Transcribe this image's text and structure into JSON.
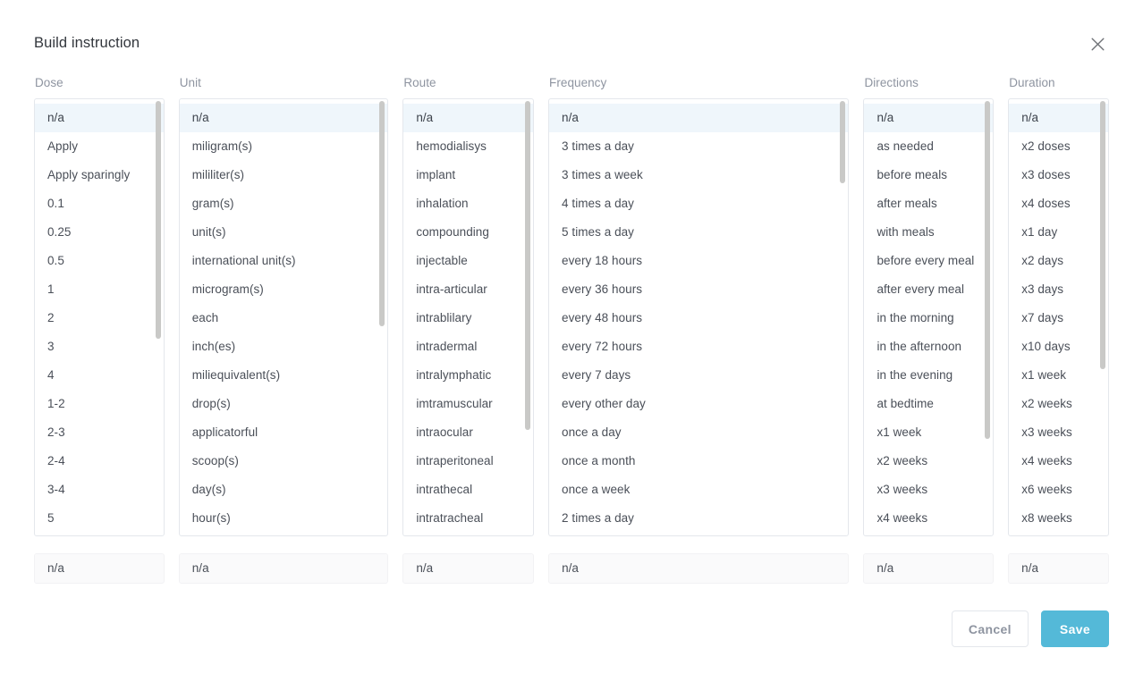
{
  "dialog": {
    "title": "Build instruction",
    "close_icon": "close-icon"
  },
  "columns": [
    {
      "key": "dose",
      "label": "Dose",
      "selected_value": "n/a",
      "scrollbar": {
        "top_pct": 0,
        "height_pct": 55
      },
      "options": [
        "n/a",
        "Apply",
        "Apply sparingly",
        "0.1",
        "0.25",
        "0.5",
        "1",
        "2",
        "3",
        "4",
        "1-2",
        "2-3",
        "2-4",
        "3-4",
        "5"
      ]
    },
    {
      "key": "unit",
      "label": "Unit",
      "selected_value": "n/a",
      "scrollbar": {
        "top_pct": 0,
        "height_pct": 52
      },
      "options": [
        "n/a",
        "miligram(s)",
        "mililiter(s)",
        "gram(s)",
        "unit(s)",
        "international unit(s)",
        "microgram(s)",
        "each",
        "inch(es)",
        "miliequivalent(s)",
        "drop(s)",
        "applicatorful",
        "scoop(s)",
        "day(s)",
        "hour(s)"
      ]
    },
    {
      "key": "route",
      "label": "Route",
      "selected_value": "n/a",
      "scrollbar": {
        "top_pct": 0,
        "height_pct": 76
      },
      "options": [
        "n/a",
        "hemodialisys",
        "implant",
        "inhalation",
        "compounding",
        "injectable",
        "intra-articular",
        "intrablilary",
        "intradermal",
        "intralymphatic",
        "imtramuscular",
        "intraocular",
        "intraperitoneal",
        "intrathecal",
        "intratracheal"
      ]
    },
    {
      "key": "frequency",
      "label": "Frequency",
      "selected_value": "n/a",
      "scrollbar": {
        "top_pct": 0,
        "height_pct": 19
      },
      "options": [
        "n/a",
        "3 times a day",
        "3 times a week",
        "4 times a day",
        "5 times a day",
        "every 18 hours",
        "every 36 hours",
        "every 48 hours",
        "every 72 hours",
        "every 7 days",
        "every other day",
        "once a day",
        "once a month",
        "once a week",
        "2 times a day"
      ]
    },
    {
      "key": "directions",
      "label": "Directions",
      "selected_value": "n/a",
      "scrollbar": {
        "top_pct": 0,
        "height_pct": 78
      },
      "options": [
        "n/a",
        "as needed",
        "before meals",
        "after meals",
        "with meals",
        "before every meal",
        "after every meal",
        "in the morning",
        "in the afternoon",
        "in the evening",
        "at bedtime",
        "x1 week",
        "x2 weeks",
        "x3 weeks",
        "x4 weeks"
      ]
    },
    {
      "key": "duration",
      "label": "Duration",
      "selected_value": "n/a",
      "scrollbar": {
        "top_pct": 0,
        "height_pct": 62
      },
      "options": [
        "n/a",
        "x2 doses",
        "x3 doses",
        "x4 doses",
        "x1 day",
        "x2 days",
        "x3 days",
        "x7 days",
        "x10 days",
        "x1 week",
        "x2 weeks",
        "x3 weeks",
        "x4 weeks",
        "x6 weeks",
        "x8 weeks"
      ]
    }
  ],
  "footer": {
    "cancel_label": "Cancel",
    "save_label": "Save"
  },
  "colors": {
    "save_button": "#54b9d8",
    "selected_row": "#eff6fb",
    "label_text": "#8e94a0"
  }
}
